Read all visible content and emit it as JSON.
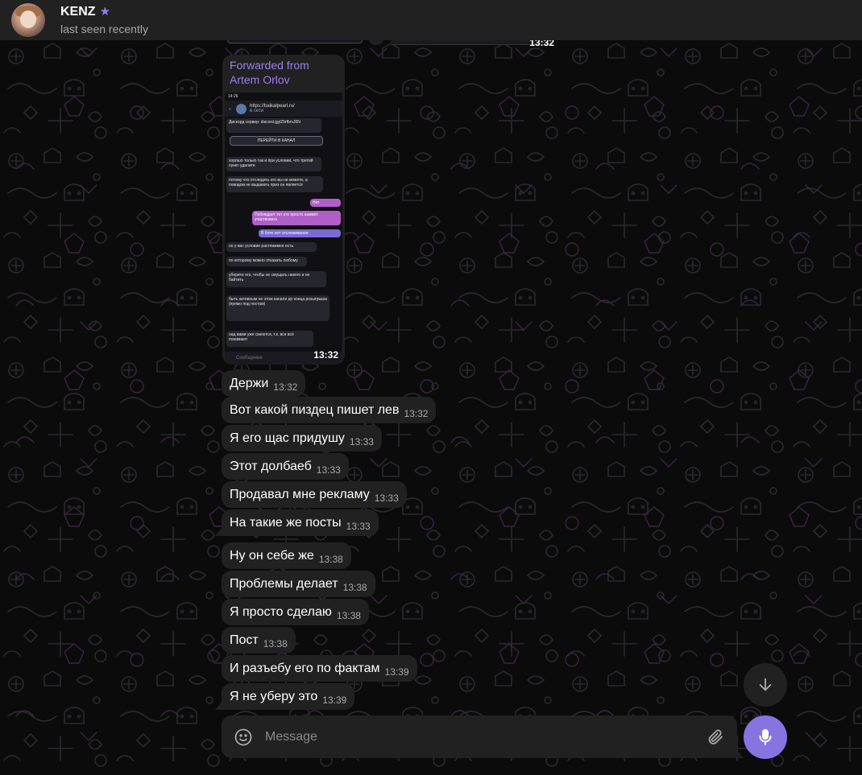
{
  "header": {
    "name": "KENZ",
    "status": "last seen recently",
    "premium_icon": "star-icon"
  },
  "top_partial_time": "13:32",
  "forwarded": {
    "label": "Forwarded from",
    "author": "Artem Orlov",
    "time": "13:32",
    "screenshot": {
      "status_time": "14:26",
      "channel": "https://baikalpearl.ru/",
      "channel_sub": "в сети",
      "discord_line": "Дискорд сервер: discord.gg/Z5rfbrvJ6N",
      "join_button": "ПЕРЕЙТИ В КАНАЛ",
      "messages": [
        "хорошо только так и при условии, что третий пункт удалите",
        "потому что отследить его вы не можете, а поводом не выдавать приз он является",
        "Нет",
        "Побеждает тот кто просто нажмёт участвовать",
        "В боте нет отслеживания",
        "но у вас условие растяжимое есть",
        "по которому можно отказать любому",
        "уберите его, чтобы не смущать никого и не байтить",
        "быть активным не этом канале до конца розыгрыша (прямо под постом)",
        "над вами уже смеются, т.к. все всё понимают"
      ],
      "composer_placeholder": "Сообщение"
    }
  },
  "messages": [
    {
      "text": "Держи",
      "time": "13:32"
    },
    {
      "text": "Вот какой пиздец пишет лев",
      "time": "13:32"
    },
    {
      "text": "Я его щас придушу",
      "time": "13:33"
    },
    {
      "text": "Этот долбаеб",
      "time": "13:33"
    },
    {
      "text": "Продавал мне рекламу",
      "time": "13:33"
    },
    {
      "text": "На такие же посты",
      "time": "13:33"
    },
    {
      "text": "Ну он себе же",
      "time": "13:38"
    },
    {
      "text": "Проблемы делает",
      "time": "13:38"
    },
    {
      "text": "Я просто сделаю",
      "time": "13:38"
    },
    {
      "text": "Пост",
      "time": "13:38"
    },
    {
      "text": "И разъебу его по фактам",
      "time": "13:39"
    },
    {
      "text": "Я не уберу это",
      "time": "13:39"
    }
  ],
  "composer": {
    "placeholder": "Message",
    "emoji_icon": "smile-icon",
    "attach_icon": "paperclip-icon",
    "mic_icon": "microphone-icon",
    "scroll_icon": "arrow-down-icon"
  },
  "colors": {
    "accent": "#8774e1",
    "bubble": "#212121",
    "header": "#212121",
    "forward_label": "#9c7ff0"
  }
}
